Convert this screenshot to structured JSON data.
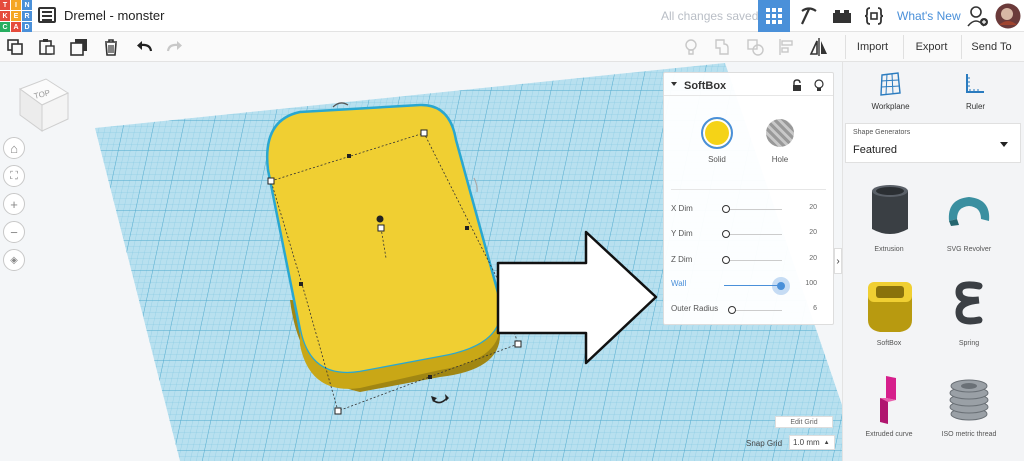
{
  "app": {
    "logo_letters": [
      "T",
      "I",
      "N",
      "K",
      "E",
      "R",
      "C",
      "A",
      "D"
    ],
    "logo_colors": [
      "#e54b3c",
      "#f5a623",
      "#4a90d9",
      "#e54b3c",
      "#f5a623",
      "#4a90d9",
      "#27ae60",
      "#e54b3c",
      "#4a90d9"
    ],
    "design_title": "Dremel - monster",
    "save_status": "All changes saved",
    "whats_new": "What's New",
    "accent": "#4a90d9"
  },
  "toolbar": {
    "import_label": "Import",
    "export_label": "Export",
    "send_to_label": "Send To"
  },
  "viewcube": {
    "face_label": "TOP"
  },
  "inspector": {
    "shape_name": "SoftBox",
    "solid_label": "Solid",
    "hole_label": "Hole",
    "solid_color": "#f2cf2f",
    "params": [
      {
        "label": "X Dim",
        "value": "20",
        "fraction": 0.0
      },
      {
        "label": "Y Dim",
        "value": "20",
        "fraction": 0.0
      },
      {
        "label": "Z Dim",
        "value": "20",
        "fraction": 0.0
      },
      {
        "label": "Wall",
        "value": "100",
        "fraction": 1.0,
        "active": true
      },
      {
        "label": "Outer Radius",
        "value": "6",
        "fraction": 0.0
      }
    ]
  },
  "right_panel": {
    "workplane_label": "Workplane",
    "ruler_label": "Ruler",
    "shape_generators_title": "Shape Generators",
    "shape_generators_value": "Featured",
    "shapes": [
      {
        "label": "Extrusion",
        "icon": "extrusion-icon"
      },
      {
        "label": "SVG Revolver",
        "icon": "svg-revolver-icon"
      },
      {
        "label": "SoftBox",
        "icon": "softbox-icon"
      },
      {
        "label": "Spring",
        "icon": "spring-icon"
      },
      {
        "label": "Extruded curve",
        "icon": "extruded-curve-icon"
      },
      {
        "label": "ISO metric thread",
        "icon": "iso-thread-icon"
      }
    ]
  },
  "grid_controls": {
    "edit_grid_label": "Edit Grid",
    "snap_grid_label": "Snap Grid",
    "snap_grid_value": "1.0 mm"
  }
}
